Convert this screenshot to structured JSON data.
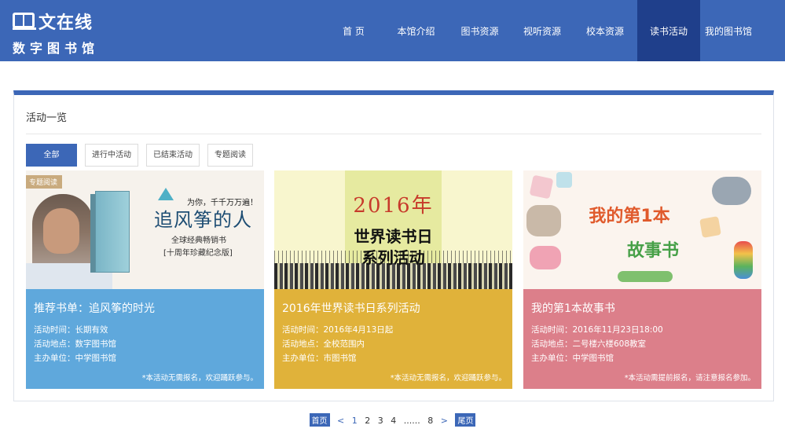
{
  "header": {
    "logo_title": "文在线",
    "logo_subtitle": "数字图书馆",
    "nav": [
      {
        "label": "首 页",
        "name": "nav-home"
      },
      {
        "label": "本馆介绍",
        "name": "nav-about"
      },
      {
        "label": "图书资源",
        "name": "nav-books"
      },
      {
        "label": "视听资源",
        "name": "nav-media"
      },
      {
        "label": "校本资源",
        "name": "nav-school"
      },
      {
        "label": "读书活动",
        "name": "nav-activities"
      },
      {
        "label": "我的图书馆",
        "name": "nav-my-library"
      }
    ],
    "active_nav": 5
  },
  "panel": {
    "title": "活动一览",
    "filters": [
      "全部",
      "进行中活动",
      "已结束活动",
      "专题阅读"
    ],
    "active_filter": 0
  },
  "cards": [
    {
      "image_tag": "专题阅读",
      "image_lines": [
        "为你，千千万万遍！",
        "追风筝的人",
        "全球经典畅销书",
        "[十周年珍藏纪念版]"
      ],
      "title": "推荐书单：追风筝的时光",
      "time": "活动时间：长期有效",
      "place": "活动地点：数字图书馆",
      "host": "主办单位：中学图书馆",
      "note": "*本活动无需报名，欢迎踊跃参与。",
      "color": "#5fa8dc"
    },
    {
      "image_lines": [
        "2016年",
        "世界读书日",
        "系列活动"
      ],
      "title": "2016年世界读书日系列活动",
      "time": "活动时间：2016年4月13日起",
      "place": "活动地点：全校范围内",
      "host": "主办单位：市图书馆",
      "note": "*本活动无需报名，欢迎踊跃参与。",
      "color": "#e0b23a"
    },
    {
      "image_lines": [
        "我的第1本",
        "故事书"
      ],
      "title": "我的第1本故事书",
      "time": "活动时间：2016年11月23日18:00",
      "place": "活动地点：二号楼六楼608教室",
      "host": "主办单位：中学图书馆",
      "note": "*本活动需提前报名，请注意报名参加。",
      "color": "#dc7f8a"
    }
  ],
  "pagination": {
    "first": "首页",
    "prev": "<",
    "pages": [
      "1",
      "2",
      "3",
      "4"
    ],
    "ellipsis": "......",
    "last_page": "8",
    "next": ">",
    "last": "尾页"
  }
}
